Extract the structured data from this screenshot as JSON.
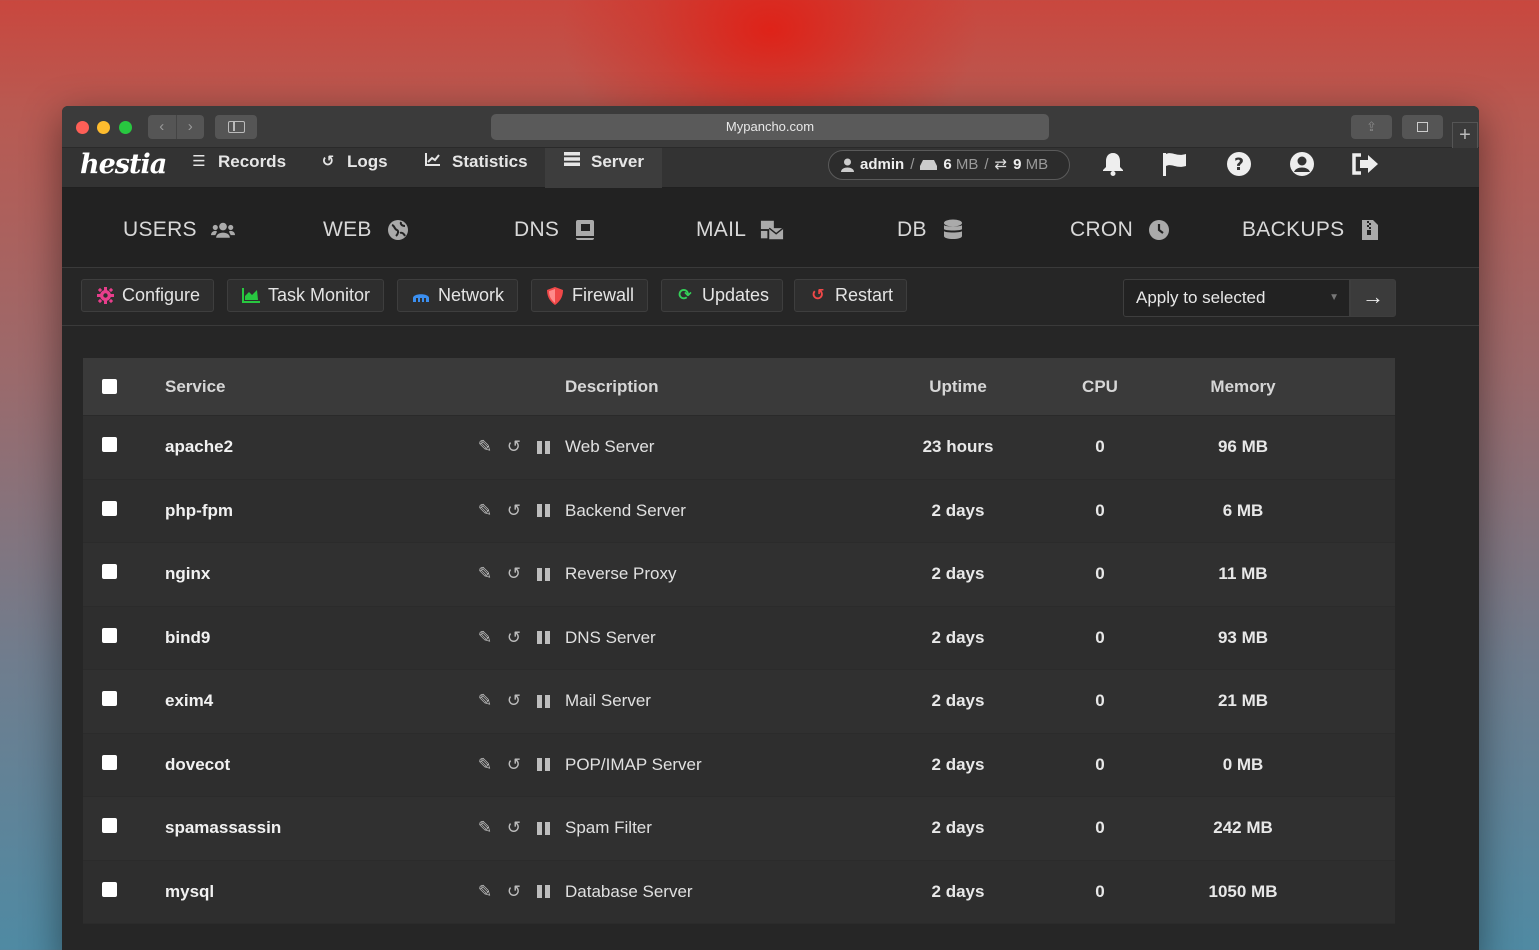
{
  "browser": {
    "url": "Mypancho.com"
  },
  "topnav": {
    "logo": "hestia",
    "items": [
      {
        "label": "Records",
        "icon": "list-icon"
      },
      {
        "label": "Logs",
        "icon": "history-icon"
      },
      {
        "label": "Statistics",
        "icon": "chart-line-icon"
      },
      {
        "label": "Server",
        "icon": "server-icon",
        "active": true
      }
    ],
    "user": {
      "name": "admin",
      "sep1": "/",
      "disk_value": "6",
      "disk_unit": "MB",
      "sep2": "/",
      "bandwidth_value": "9",
      "bandwidth_unit": "MB"
    }
  },
  "mainnav": {
    "items": [
      {
        "label": "USERS",
        "icon": "users-icon"
      },
      {
        "label": "WEB",
        "icon": "globe-icon"
      },
      {
        "label": "DNS",
        "icon": "book-icon"
      },
      {
        "label": "MAIL",
        "icon": "mail-bulk-icon"
      },
      {
        "label": "DB",
        "icon": "database-icon"
      },
      {
        "label": "CRON",
        "icon": "clock-icon"
      },
      {
        "label": "BACKUPS",
        "icon": "file-archive-icon"
      }
    ]
  },
  "toolbar": {
    "buttons": [
      {
        "label": "Configure",
        "icon": "gear-icon",
        "color": "#e83e8c"
      },
      {
        "label": "Task Monitor",
        "icon": "chart-area-icon",
        "color": "#28c840"
      },
      {
        "label": "Network",
        "icon": "network-wired-icon",
        "color": "#3b8ff0"
      },
      {
        "label": "Firewall",
        "icon": "shield-icon",
        "color": "#f04848"
      },
      {
        "label": "Updates",
        "icon": "sync-icon",
        "color": "#34d058"
      },
      {
        "label": "Restart",
        "icon": "undo-icon",
        "color": "#f04848"
      }
    ],
    "bulk_select": "Apply to selected"
  },
  "table": {
    "headers": {
      "service": "Service",
      "description": "Description",
      "uptime": "Uptime",
      "cpu": "CPU",
      "memory": "Memory"
    },
    "rows": [
      {
        "service": "apache2",
        "description": "Web Server",
        "uptime": "23 hours",
        "cpu": "0",
        "memory": "96 MB"
      },
      {
        "service": "php-fpm",
        "description": "Backend Server",
        "uptime": "2 days",
        "cpu": "0",
        "memory": "6 MB"
      },
      {
        "service": "nginx",
        "description": "Reverse Proxy",
        "uptime": "2 days",
        "cpu": "0",
        "memory": "11 MB"
      },
      {
        "service": "bind9",
        "description": "DNS Server",
        "uptime": "2 days",
        "cpu": "0",
        "memory": "93 MB"
      },
      {
        "service": "exim4",
        "description": "Mail Server",
        "uptime": "2 days",
        "cpu": "0",
        "memory": "21 MB"
      },
      {
        "service": "dovecot",
        "description": "POP/IMAP Server",
        "uptime": "2 days",
        "cpu": "0",
        "memory": "0 MB"
      },
      {
        "service": "spamassassin",
        "description": "Spam Filter",
        "uptime": "2 days",
        "cpu": "0",
        "memory": "242 MB"
      },
      {
        "service": "mysql",
        "description": "Database Server",
        "uptime": "2 days",
        "cpu": "0",
        "memory": "1050 MB"
      }
    ]
  }
}
